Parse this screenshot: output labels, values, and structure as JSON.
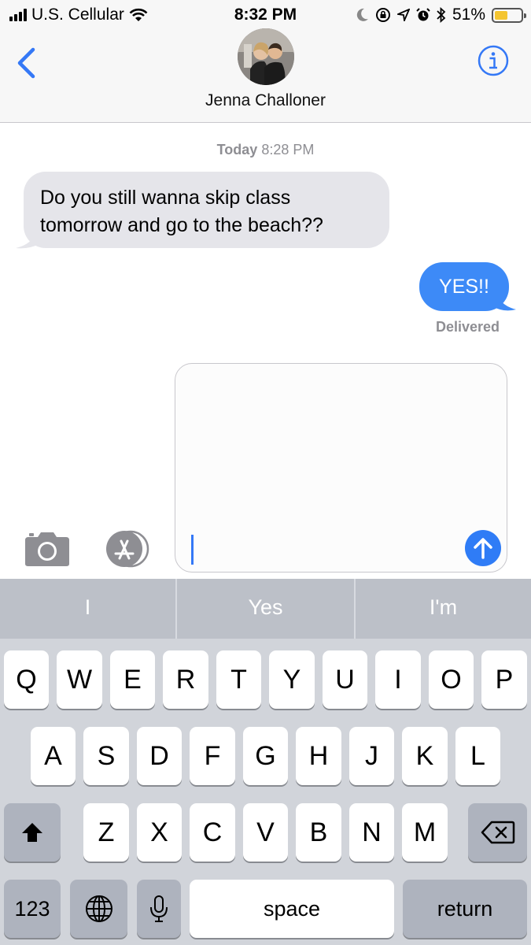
{
  "status_bar": {
    "carrier": "U.S. Cellular",
    "time": "8:32 PM",
    "battery_percent": "51%",
    "battery_level": 0.51,
    "battery_color": "#f4c531",
    "icons": [
      "moon-icon",
      "rotation-lock-icon",
      "location-arrow-icon",
      "alarm-icon",
      "bluetooth-icon"
    ]
  },
  "header": {
    "contact_name": "Jenna Challoner",
    "back_icon": "chevron-left-icon",
    "info_icon": "info-icon"
  },
  "conversation": {
    "timestamp_day": "Today",
    "timestamp_time": "8:28 PM",
    "incoming_message_line1": "Do you still wanna skip class",
    "incoming_message_line2": "tomorrow and go to the beach??",
    "outgoing_message": "YES!!",
    "delivery_status": "Delivered",
    "outgoing_color": "#3d8af7",
    "incoming_color": "#e5e5ea"
  },
  "composer": {
    "text": "",
    "camera_icon": "camera-icon",
    "apps_icon": "app-store-icon",
    "send_icon": "send-arrow-icon"
  },
  "keyboard": {
    "suggestions": [
      "I",
      "Yes",
      "I'm"
    ],
    "row1": [
      "Q",
      "W",
      "E",
      "R",
      "T",
      "Y",
      "U",
      "I",
      "O",
      "P"
    ],
    "row2": [
      "A",
      "S",
      "D",
      "F",
      "G",
      "H",
      "J",
      "K",
      "L"
    ],
    "row3": [
      "Z",
      "X",
      "C",
      "V",
      "B",
      "N",
      "M"
    ],
    "numbers_label": "123",
    "space_label": "space",
    "return_label": "return"
  }
}
